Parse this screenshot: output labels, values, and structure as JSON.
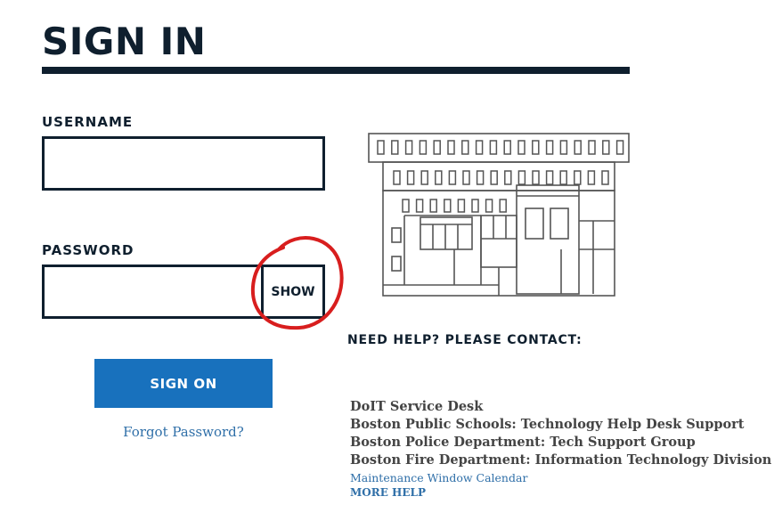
{
  "page": {
    "title": "SIGN IN"
  },
  "form": {
    "username_label": "USERNAME",
    "username_value": "",
    "password_label": "PASSWORD",
    "password_value": "",
    "show_label": "SHOW",
    "submit_label": "SIGN ON",
    "forgot_label": "Forgot Password?"
  },
  "help": {
    "heading": "NEED HELP? PLEASE CONTACT:",
    "contacts": [
      "DoIT Service Desk",
      "Boston Public Schools: Technology Help Desk Support",
      "Boston Police Department: Tech Support Group",
      "Boston Fire Department: Information Technology Division"
    ],
    "calendar_link": "Maintenance Window Calendar",
    "more_help": "MORE HELP"
  },
  "colors": {
    "navy": "#0f1f2e",
    "primary_button": "#1871bd",
    "link": "#2f6fa8",
    "annotation": "#d81e1e"
  },
  "icons": {
    "illustration": "city-hall-building-icon",
    "annotation": "red-circle-annotation"
  }
}
